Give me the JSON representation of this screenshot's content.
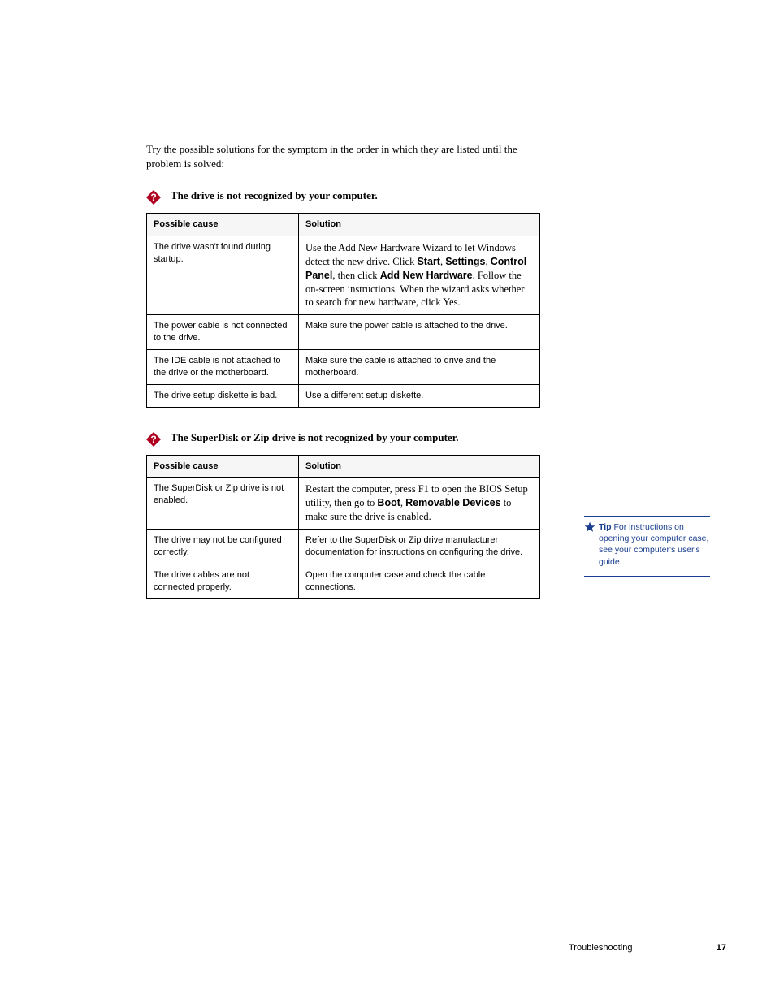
{
  "intro": "Try the possible solutions for the symptom in the order in which they are listed until the problem is solved:",
  "question1": {
    "text": "The drive is not recognized by your computer."
  },
  "table1": {
    "headers": [
      "Possible cause",
      "Solution"
    ],
    "rows": [
      {
        "cause": "The drive wasn't found during startup.",
        "solution_pre": "Use the Add New Hardware Wizard to let Windows detect the new drive. Click ",
        "b1": "Start",
        "mid1": ", ",
        "b2": "Settings",
        "mid2": ", ",
        "b3": "Control Panel",
        "mid3": ", then click ",
        "b4": "Add New Hardware",
        "suffix": ". Follow the on-screen instructions. When the wizard asks whether to search for new hardware, click Yes."
      },
      {
        "cause": "The power cable is not connected to the drive.",
        "solution": "Make sure the power cable is attached to the drive."
      },
      {
        "cause": "The IDE cable is not attached to the drive or the motherboard.",
        "solution": "Make sure the cable is attached to drive and the motherboard."
      },
      {
        "cause": "The drive setup diskette is bad.",
        "solution": "Use a different setup diskette."
      }
    ]
  },
  "question2": {
    "text": "The SuperDisk or Zip drive is not recognized by your computer."
  },
  "table2": {
    "headers": [
      "Possible cause",
      "Solution"
    ],
    "rows": [
      {
        "cause": "The SuperDisk or Zip drive is not enabled.",
        "solution_pre": "Restart the computer, press ",
        "key": "F1",
        "mid1": " to open the BIOS Setup utility, then go to ",
        "b1": "Boot",
        "mid2": ", ",
        "b2": "Removable Devices",
        "suffix": " to make sure the drive is enabled."
      },
      {
        "cause": "The drive may not be configured correctly.",
        "solution": "Refer to the SuperDisk or Zip drive manufacturer documentation for instructions on configuring the drive."
      },
      {
        "cause": "The drive cables are not connected properly.",
        "solution": "Open the computer case and check the cable connections."
      }
    ]
  },
  "tip": {
    "label": "Tip",
    "body": " For instructions on opening your computer case, see your computer's user's guide."
  },
  "footer": {
    "title": "Troubleshooting",
    "page": "17"
  }
}
